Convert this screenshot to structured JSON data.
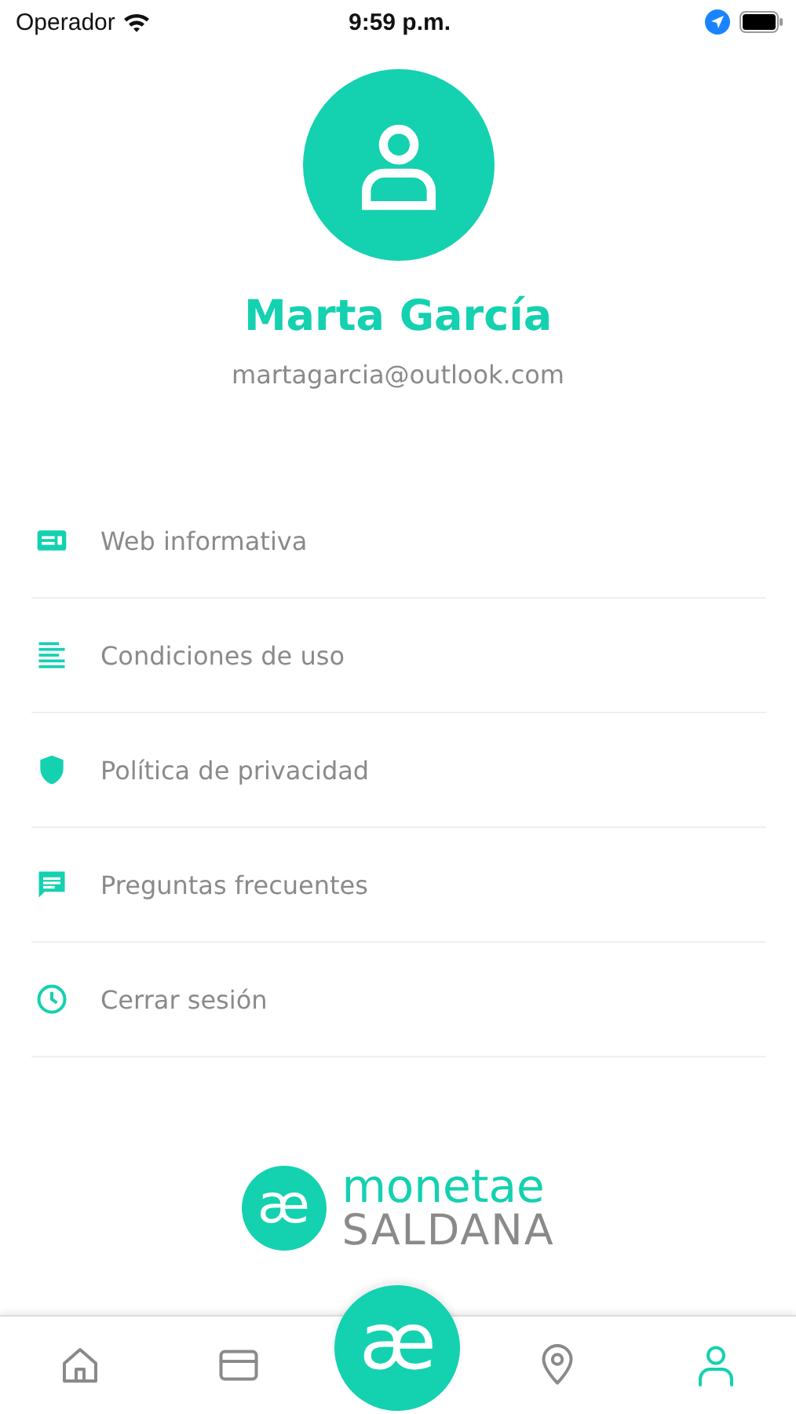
{
  "status_bar": {
    "carrier": "Operador",
    "time": "9:59 p.m."
  },
  "profile": {
    "name": "Marta García",
    "email": "martagarcia@outlook.com"
  },
  "menu": [
    {
      "kind": "web",
      "label": "Web informativa"
    },
    {
      "kind": "terms",
      "label": "Condiciones de uso"
    },
    {
      "kind": "privacy",
      "label": "Política de privacidad"
    },
    {
      "kind": "faq",
      "label": "Preguntas frecuentes"
    },
    {
      "kind": "logout",
      "label": "Cerrar sesión"
    }
  ],
  "brand": {
    "mark": "æ",
    "line_1": "monetae",
    "line_2": "SALDANA"
  },
  "nav": [
    {
      "kind": "home",
      "selected": false
    },
    {
      "kind": "card",
      "selected": false
    },
    {
      "kind": "logo",
      "label": "æ",
      "selected": false
    },
    {
      "kind": "map",
      "selected": false
    },
    {
      "kind": "profile",
      "selected": true
    }
  ]
}
